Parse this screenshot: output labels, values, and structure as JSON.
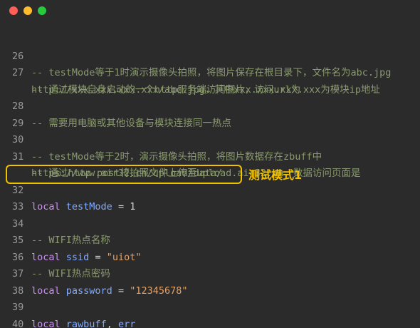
{
  "window": {
    "controls": [
      "close",
      "minimize",
      "zoom"
    ]
  },
  "colors": {
    "comment": "#8a9a6e",
    "keyword": "#c792ea",
    "variable": "#82aaff",
    "string": "#e2a36b",
    "highlight": "#f2c100"
  },
  "code": {
    "l26": {
      "num": "26",
      "text": "-- testMode等于1时演示摄像头拍照，将图片保存在根目录下，文件名为abc.jpg"
    },
    "l27": {
      "num": "27",
      "text": "-- 通过模块自身启动的一个http服务端访问图片，访问url为"
    },
    "l27b": {
      "text": "http://xxx.xxx.xxx.xxx/abc.jpg，其中xxx.xxx.xxx.xxx为模块ip地址"
    },
    "l28": {
      "num": "28",
      "text": "-- 需要用电脑或其他设备与模块连接同一热点"
    },
    "l29": {
      "num": "29",
      "text": ""
    },
    "l30": {
      "num": "30",
      "text": "-- testMode等于2时，演示摄像头拍照，将图片数据存在zbuff中"
    },
    "l31": {
      "num": "31",
      "text": "-- 通过http post将拍照文件上传至upload.air32.cn，数据访问页面是"
    },
    "l31b": {
      "text": "https://www.air32.cn/upload/data/"
    },
    "l32": {
      "num": "32",
      "kw": "local",
      "var": "testMode",
      "op": "=",
      "val": "1"
    },
    "l33": {
      "num": "33",
      "text": ""
    },
    "l34": {
      "num": "34",
      "text": "-- WIFI热点名称"
    },
    "l35": {
      "num": "35",
      "kw": "local",
      "var": "ssid",
      "op": "=",
      "val": "\"uiot\""
    },
    "l36": {
      "num": "36",
      "text": "-- WIFI热点密码"
    },
    "l37": {
      "num": "37",
      "kw": "local",
      "var": "password",
      "op": "=",
      "val": "\"12345678\""
    },
    "l38": {
      "num": "38",
      "text": ""
    },
    "l39": {
      "num": "39",
      "kw": "local",
      "var": "rawbuff",
      "sep": ",",
      "var2": "err"
    },
    "l40": {
      "num": "40",
      "text": ""
    }
  },
  "annotation": {
    "label": "测试模式1"
  }
}
